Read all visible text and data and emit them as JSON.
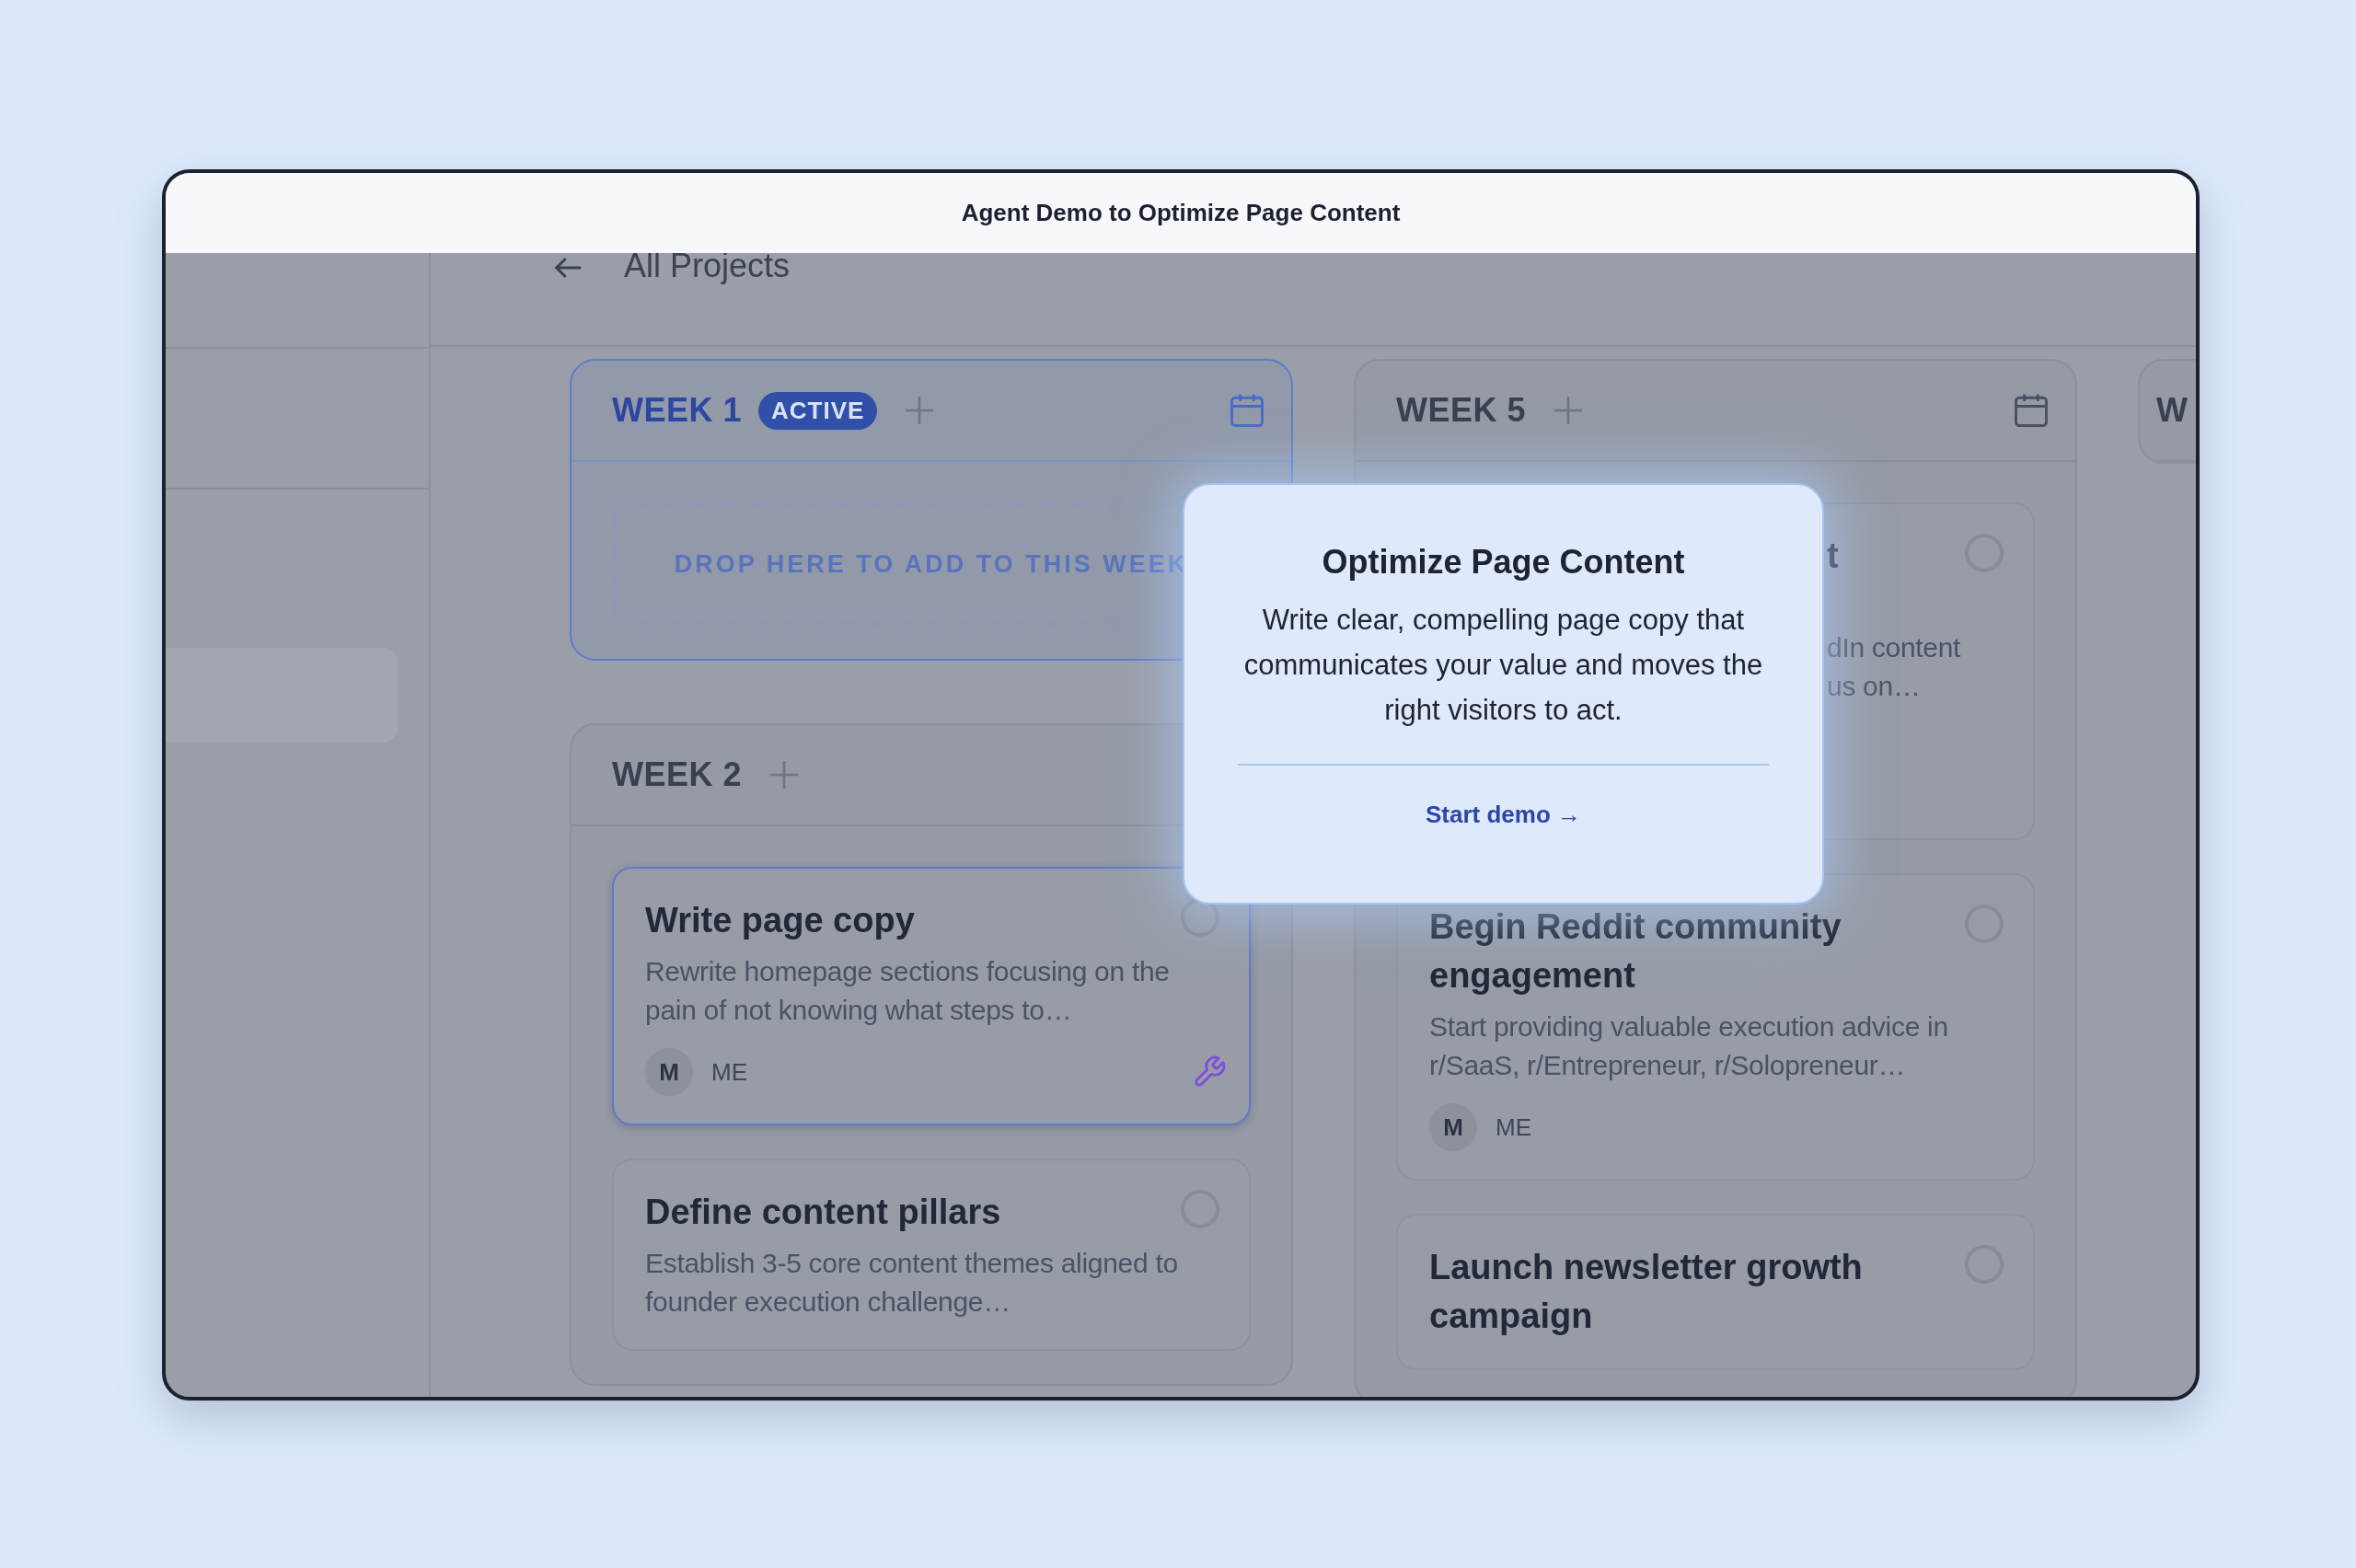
{
  "window": {
    "title": "Agent Demo to Optimize Page Content"
  },
  "nav": {
    "back_label": "All Projects"
  },
  "columns": [
    {
      "weeks": [
        {
          "title": "WEEK 1",
          "active": true,
          "badge": "ACTIVE",
          "calendar": true,
          "dropzone": "DROP HERE TO ADD TO THIS WEEK"
        },
        {
          "title": "WEEK 2",
          "active": false,
          "calendar": false,
          "tasks": [
            {
              "kind": "task",
              "title": "Write page copy",
              "description": "Rewrite homepage sections focusing on the pain of not knowing what steps to…",
              "done": false,
              "selected": true,
              "tool": true,
              "assignee": {
                "initial": "M",
                "name": "ME"
              }
            },
            {
              "kind": "task",
              "title": "Define content pillars",
              "description": "Establish 3-5 core content themes aligned to founder execution challenge…",
              "done": false,
              "selected": false,
              "tool": false
            }
          ]
        }
      ]
    },
    {
      "weeks": [
        {
          "title": "WEEK 5",
          "active": false,
          "calendar": true,
          "tasks": [
            {
              "kind": "covered",
              "title": "t",
              "description": "dIn content\nus on…",
              "done": false,
              "selected": false,
              "tool": false
            },
            {
              "kind": "task",
              "title": "Begin Reddit community engagement",
              "description": "Start providing valuable execution advice in r/SaaS, r/Entrepreneur, r/Solopreneur…",
              "done": false,
              "selected": false,
              "tool": false,
              "assignee": {
                "initial": "M",
                "name": "ME"
              }
            },
            {
              "kind": "task",
              "title": "Launch newsletter growth campaign",
              "done": false,
              "selected": false,
              "tool": false
            }
          ]
        }
      ]
    },
    {
      "weeks": [
        {
          "title": "W",
          "active": false,
          "calendar": false
        }
      ]
    }
  ],
  "popover": {
    "title": "Optimize Page Content",
    "body": "Write clear, compelling page copy that communicates your value and moves the right visitors to act.",
    "link": "Start demo →"
  }
}
